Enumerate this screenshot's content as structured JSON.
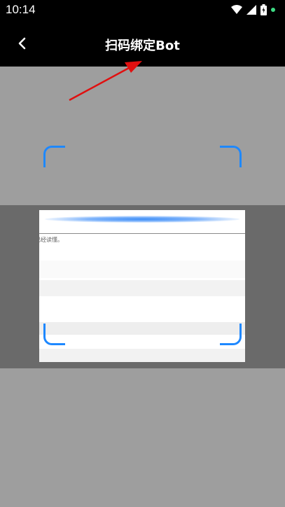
{
  "status_bar": {
    "time": "10:14",
    "icons": [
      "wifi-icon",
      "signal-icon",
      "battery-icon",
      "notification-dot"
    ]
  },
  "app_bar": {
    "title": "扫码绑定Bot",
    "back_icon": "chevron-left-icon"
  },
  "scanner": {
    "preview_text": "已经读懂。",
    "frame_color": "#1e88ff",
    "annotation_color": "#e01010"
  }
}
